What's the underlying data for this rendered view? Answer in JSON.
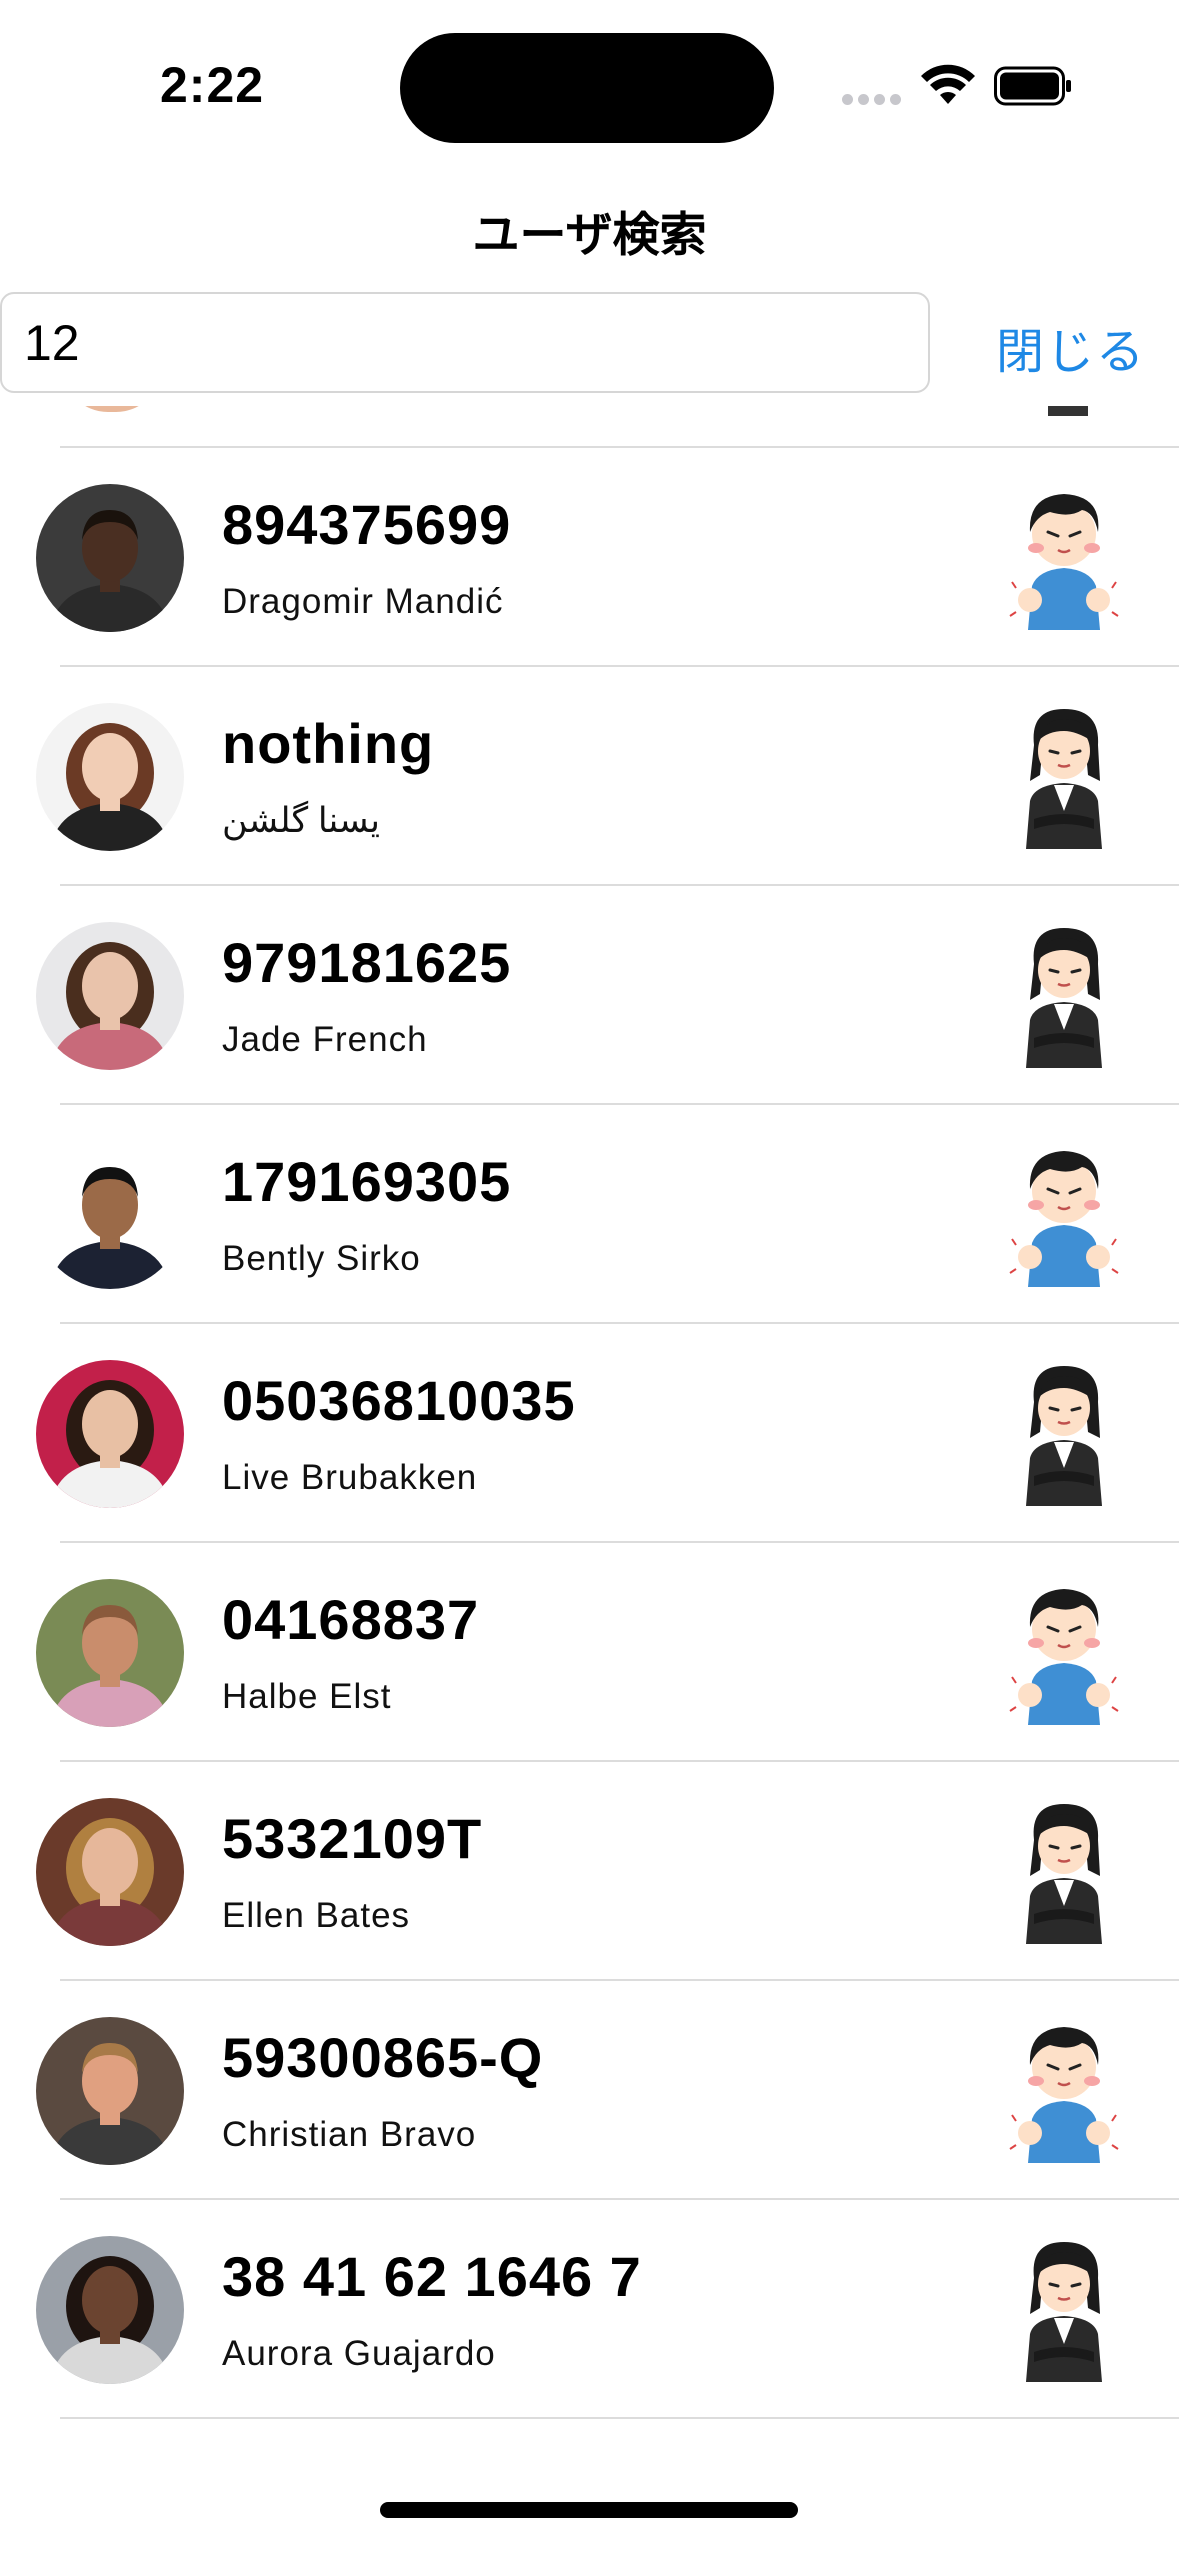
{
  "status": {
    "time": "2:22"
  },
  "nav": {
    "title": "ユーザ検索"
  },
  "search": {
    "value": "12",
    "close_label": "閉じる"
  },
  "users": [
    {
      "id": "894375699",
      "name": "Dragomir Mandić",
      "gender": "male",
      "skin": "#4a2f22",
      "hair": "#1a120c",
      "bg": "#3b3b3b",
      "shirt": "#2a2a2a"
    },
    {
      "id": "nothing",
      "name": "یسنا گلشن",
      "gender": "female",
      "skin": "#f1cdb5",
      "hair": "#6b3a25",
      "bg": "#f3f3f3",
      "shirt": "#222222"
    },
    {
      "id": "979181625",
      "name": "Jade French",
      "gender": "female",
      "skin": "#e9c3ab",
      "hair": "#4a2e1e",
      "bg": "#e8e8ea",
      "shirt": "#c86a7a"
    },
    {
      "id": "179169305",
      "name": "Bently Sirko",
      "gender": "male",
      "skin": "#9b6a48",
      "hair": "#111111",
      "bg": "#ffffff",
      "shirt": "#1c2233"
    },
    {
      "id": "05036810035",
      "name": "Live Brubakken",
      "gender": "female",
      "skin": "#e8c0a4",
      "hair": "#2a1a12",
      "bg": "#c2204a",
      "shirt": "#f2f2f2"
    },
    {
      "id": "04168837",
      "name": "Halbe Elst",
      "gender": "male",
      "skin": "#c98d6c",
      "hair": "#8a5a3c",
      "bg": "#7a8b55",
      "shirt": "#d8a0b8"
    },
    {
      "id": "5332109T",
      "name": "Ellen Bates",
      "gender": "female",
      "skin": "#e6b79a",
      "hair": "#b08040",
      "bg": "#6a3a2a",
      "shirt": "#7a3a3a"
    },
    {
      "id": "59300865-Q",
      "name": "Christian Bravo",
      "gender": "male",
      "skin": "#e0a080",
      "hair": "#a87a48",
      "bg": "#5a4a40",
      "shirt": "#3a3a3a"
    },
    {
      "id": "38 41 62 1646 7",
      "name": "Aurora Guajardo",
      "gender": "female",
      "skin": "#6b4430",
      "hair": "#1e1410",
      "bg": "#9aa0a8",
      "shirt": "#d9d9d9"
    }
  ],
  "colors": {
    "accent": "#1e88e5",
    "separator": "#dcdcdc"
  }
}
